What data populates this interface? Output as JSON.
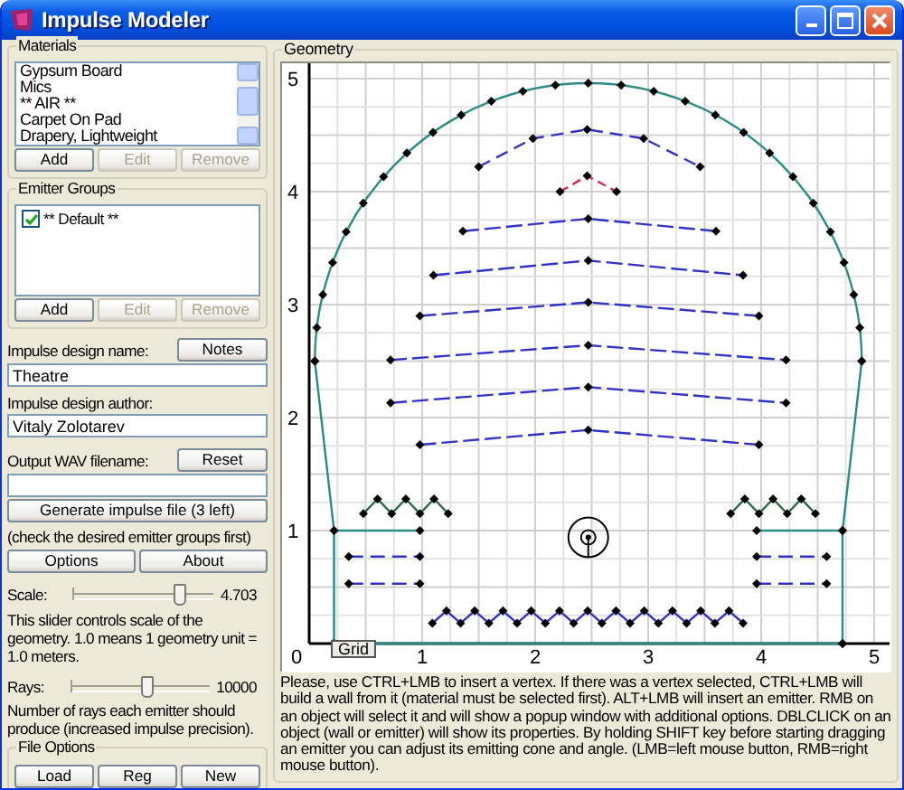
{
  "window": {
    "title": "Impulse Modeler"
  },
  "materials": {
    "title": "Materials",
    "items": [
      {
        "label": "Gypsum Board",
        "selected": false
      },
      {
        "label": "Mics",
        "selected": false
      },
      {
        "label": "** AIR **",
        "selected": false
      },
      {
        "label": "Carpet On Pad",
        "selected": false
      },
      {
        "label": "Drapery, Lightweight",
        "selected": false
      }
    ],
    "buttons": [
      {
        "label": "Add",
        "disabled": false
      },
      {
        "label": "Edit",
        "disabled": true
      },
      {
        "label": "Remove",
        "disabled": true
      }
    ]
  },
  "emitter_groups": {
    "title": "Emitter Groups",
    "items": [
      {
        "label": "** Default **",
        "checked": true
      }
    ],
    "buttons": [
      {
        "label": "Add",
        "disabled": false
      },
      {
        "label": "Edit",
        "disabled": true
      },
      {
        "label": "Remove",
        "disabled": true
      }
    ]
  },
  "design_name": {
    "label": "Impulse design name:",
    "button": "Notes",
    "value": "Theatre"
  },
  "design_author": {
    "label": "Impulse design author:",
    "value": "Vitaly Zolotarev"
  },
  "output_wav": {
    "label": "Output WAV filename:",
    "button": "Reset"
  },
  "generate_button": "Generate impulse file (3 left)",
  "generate_hint": "(check the desired emitter groups first)",
  "buttons": [
    "Options",
    "About"
  ],
  "scale": {
    "label": "Scale:",
    "level": 0.76,
    "reading": "4.703",
    "description": "This slider controls scale of the geometry. 1.0 means 1 geometry unit = 1.0 meters."
  },
  "rays": {
    "label": "Rays:",
    "level": 0.55,
    "reading": "10000",
    "description": "Number of rays each emitter should produce (increased impulse precision)."
  },
  "file_options": {
    "title": "File Options",
    "buttons": [
      "Load",
      "Reg",
      "New"
    ]
  },
  "geometry": {
    "title": "Geometry",
    "x_ticks": [
      "0",
      "1",
      "2",
      "3",
      "4",
      "5"
    ],
    "y_ticks": [
      "5",
      "4",
      "3",
      "2",
      "1"
    ],
    "grid_button": "Grid",
    "help": "Please, use CTRL+LMB to insert a vertex. If there was a vertex selected, CTRL+LMB will build a wall from it (material must be selected first). ALT+LMB will insert an emitter. RMB on an object will select it and will show a popup window with additional options. DBLCLICK on an object (wall or emitter) will show its properties. By holding SHIFT key before starting dragging an emitter you can adjust its emitting cone and angle. (LMB=left mouse button, RMB=right mouse button)."
  }
}
